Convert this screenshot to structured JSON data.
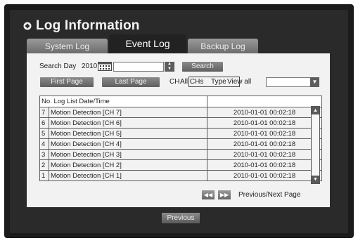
{
  "window": {
    "title": "Log Information"
  },
  "tabs": [
    {
      "label": "System Log",
      "active": false
    },
    {
      "label": "Event Log",
      "active": true
    },
    {
      "label": "Backup Log",
      "active": false
    }
  ],
  "search": {
    "day_label": "Search Day",
    "year": "2010",
    "date_value": "",
    "search_button": "Search"
  },
  "paging": {
    "first_page": "First Page",
    "last_page": "Last Page",
    "label": "Previous/Next Page"
  },
  "filters": {
    "ch_label": "CH",
    "ch_value": "All CHs",
    "type_label": "Type",
    "type_value": "View all",
    "type_select_value": ""
  },
  "table": {
    "headers": [
      "No.",
      "Log List",
      "Date/Time"
    ],
    "rows": [
      {
        "no": "7",
        "event": "Motion Detection [CH 7]",
        "datetime": "2010-01-01 00:02:18"
      },
      {
        "no": "6",
        "event": "Motion Detection [CH 6]",
        "datetime": "2010-01-01 00:02:18"
      },
      {
        "no": "5",
        "event": "Motion Detection [CH 5]",
        "datetime": "2010-01-01 00:02:18"
      },
      {
        "no": "4",
        "event": "Motion Detection [CH 4]",
        "datetime": "2010-01-01 00:02:18"
      },
      {
        "no": "3",
        "event": "Motion Detection [CH 3]",
        "datetime": "2010-01-01 00:02:18"
      },
      {
        "no": "2",
        "event": "Motion Detection [CH 2]",
        "datetime": "2010-01-01 00:02:18"
      },
      {
        "no": "1",
        "event": "Motion Detection [CH 1]",
        "datetime": "2010-01-01 00:02:18"
      }
    ]
  },
  "footer": {
    "previous_button": "Previous"
  },
  "icons": {
    "title": "diamond-bullet-icon",
    "calendar": "calendar-icon",
    "spin": "spinner-arrows-icon",
    "dropdown": "chevron-down-icon",
    "prev": "rewind-icon",
    "next": "fast-forward-icon"
  },
  "colors": {
    "background": "#2a2a2a",
    "panel": "#f2f2f2",
    "button": "#6f6f6f"
  }
}
